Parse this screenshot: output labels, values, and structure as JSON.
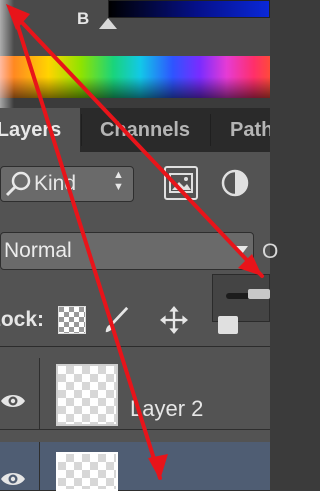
{
  "color_panel": {
    "channel_label": "B",
    "accent_color": "#0d1fae"
  },
  "tabs": [
    {
      "label": "Layers",
      "active": true
    },
    {
      "label": "Channels",
      "active": false
    },
    {
      "label": "Paths",
      "active": false
    }
  ],
  "filter": {
    "kind_label": "Kind",
    "search_icon": "search-icon",
    "arrows": "▲▼"
  },
  "blend": {
    "mode": "Normal",
    "opacity_label_clipped": "O"
  },
  "lock": {
    "label": "Lock:"
  },
  "layers": [
    {
      "name": "Layer 2",
      "visible": true,
      "selected": false
    },
    {
      "name": "",
      "visible": true,
      "selected": true
    }
  ],
  "annotation": {
    "arrow_color": "#e8141a"
  }
}
